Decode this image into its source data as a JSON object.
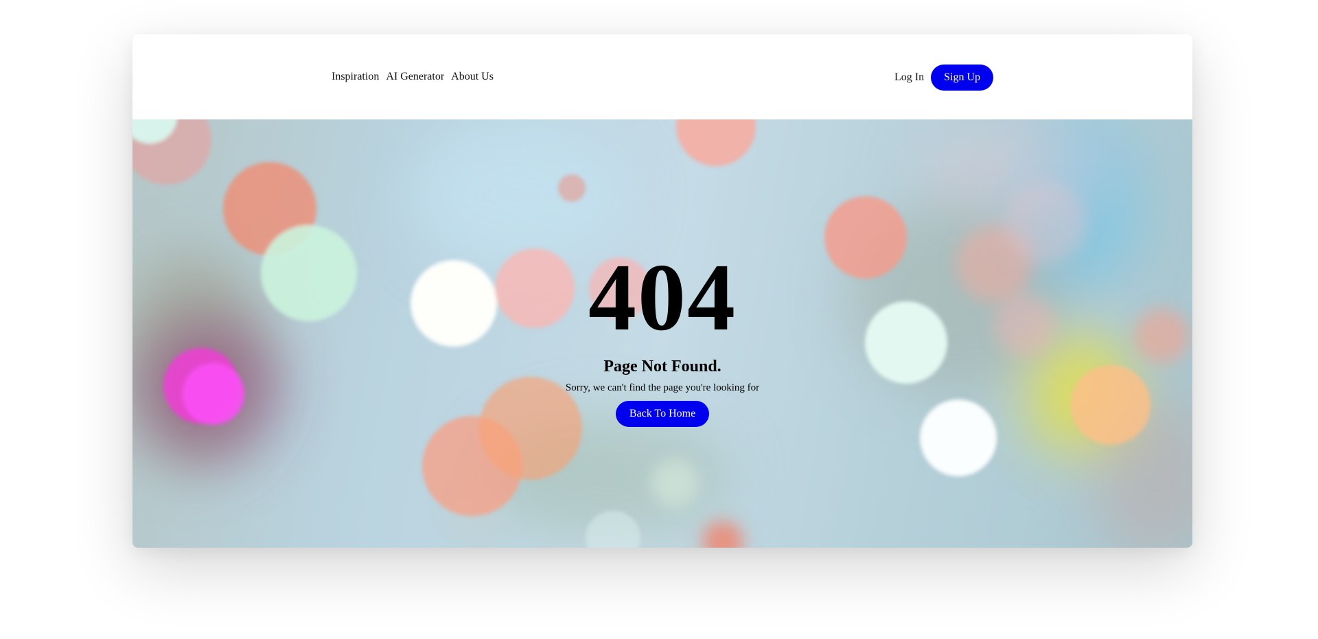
{
  "nav": {
    "links": [
      "Inspiration",
      "AI Generator",
      "About Us"
    ],
    "login_label": "Log In",
    "signup_label": "Sign Up"
  },
  "error": {
    "code": "404",
    "title": "Page Not Found.",
    "message": "Sorry, we can't find the page you're looking for",
    "button_label": "Back To Home"
  },
  "colors": {
    "accent": "#0000ee",
    "text": "#000000",
    "background": "#ffffff"
  }
}
